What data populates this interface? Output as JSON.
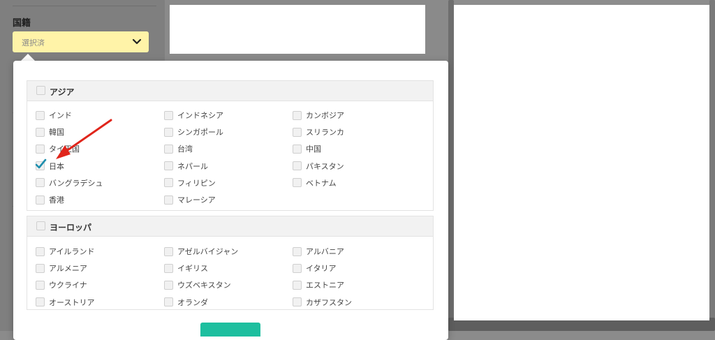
{
  "filter": {
    "nationality_label": "国籍",
    "nationality_select_value": "選択済"
  },
  "regions": [
    {
      "name": "アジア",
      "countries": [
        {
          "label": "インド",
          "checked": false
        },
        {
          "label": "インドネシア",
          "checked": false
        },
        {
          "label": "カンボジア",
          "checked": false
        },
        {
          "label": "韓国",
          "checked": false
        },
        {
          "label": "シンガポール",
          "checked": false
        },
        {
          "label": "スリランカ",
          "checked": false
        },
        {
          "label": "タイ王国",
          "checked": false
        },
        {
          "label": "台湾",
          "checked": false
        },
        {
          "label": "中国",
          "checked": false
        },
        {
          "label": "日本",
          "checked": true
        },
        {
          "label": "ネパール",
          "checked": false
        },
        {
          "label": "パキスタン",
          "checked": false
        },
        {
          "label": "バングラデシュ",
          "checked": false
        },
        {
          "label": "フィリピン",
          "checked": false
        },
        {
          "label": "ベトナム",
          "checked": false
        },
        {
          "label": "香港",
          "checked": false
        },
        {
          "label": "マレーシア",
          "checked": false
        }
      ]
    },
    {
      "name": "ヨーロッパ",
      "countries": [
        {
          "label": "アイルランド",
          "checked": false
        },
        {
          "label": "アゼルバイジャン",
          "checked": false
        },
        {
          "label": "アルバニア",
          "checked": false
        },
        {
          "label": "アルメニア",
          "checked": false
        },
        {
          "label": "イギリス",
          "checked": false
        },
        {
          "label": "イタリア",
          "checked": false
        },
        {
          "label": "ウクライナ",
          "checked": false
        },
        {
          "label": "ウズベキスタン",
          "checked": false
        },
        {
          "label": "エストニア",
          "checked": false
        },
        {
          "label": "オーストリア",
          "checked": false
        },
        {
          "label": "オランダ",
          "checked": false
        },
        {
          "label": "カザフスタン",
          "checked": false
        }
      ]
    }
  ],
  "colors": {
    "select_bg": "#fff3a8",
    "check_accent": "#1f8fae",
    "submit_bg": "#1dbf9f",
    "annotation_arrow": "#e0251b"
  }
}
